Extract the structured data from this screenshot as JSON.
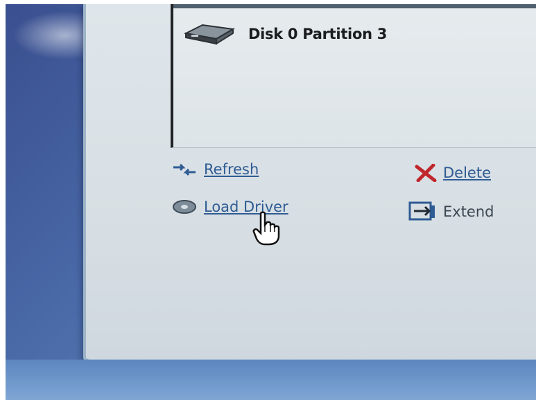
{
  "partition_list": {
    "items": [
      {
        "label": "Disk 0 Partition 3"
      }
    ]
  },
  "actions": {
    "refresh": "Refresh",
    "load_driver": "Load Driver",
    "delete": "Delete",
    "extend": "Extend"
  }
}
